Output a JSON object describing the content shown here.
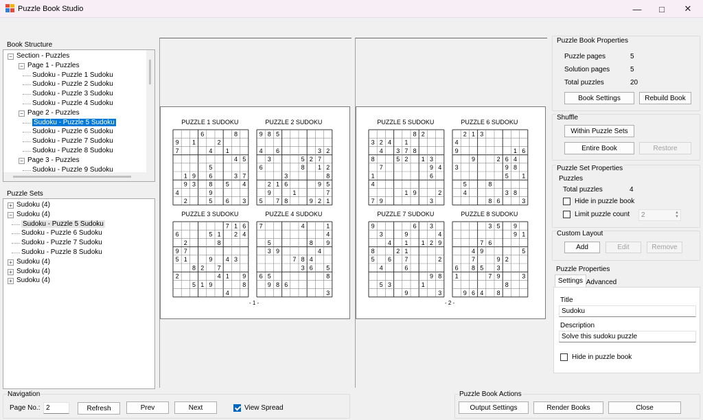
{
  "window": {
    "title": "Puzzle Book Studio",
    "minimize_glyph": "—",
    "maximize_glyph": "□",
    "close_glyph": "✕"
  },
  "book_structure": {
    "label": "Book Structure",
    "rows": [
      {
        "text": "Section - Puzzles",
        "depth": 0,
        "exp": "−"
      },
      {
        "text": "Page 1 - Puzzles",
        "depth": 1,
        "exp": "−"
      },
      {
        "text": "Sudoku - Puzzle 1 Sudoku",
        "depth": 2
      },
      {
        "text": "Sudoku - Puzzle 2 Sudoku",
        "depth": 2
      },
      {
        "text": "Sudoku - Puzzle 3 Sudoku",
        "depth": 2
      },
      {
        "text": "Sudoku - Puzzle 4 Sudoku",
        "depth": 2
      },
      {
        "text": "Page 2 - Puzzles",
        "depth": 1,
        "exp": "−"
      },
      {
        "text": "Sudoku - Puzzle 5 Sudoku",
        "depth": 2,
        "selected": true
      },
      {
        "text": "Sudoku - Puzzle 6 Sudoku",
        "depth": 2
      },
      {
        "text": "Sudoku - Puzzle 7 Sudoku",
        "depth": 2
      },
      {
        "text": "Sudoku - Puzzle 8 Sudoku",
        "depth": 2
      },
      {
        "text": "Page 3 - Puzzles",
        "depth": 1,
        "exp": "−"
      },
      {
        "text": "Sudoku - Puzzle 9 Sudoku",
        "depth": 2
      }
    ]
  },
  "puzzle_sets": {
    "label": "Puzzle Sets",
    "rows": [
      {
        "text": "Sudoku (4)",
        "depth": 0,
        "exp": "+"
      },
      {
        "text": "Sudoku (4)",
        "depth": 0,
        "exp": "−"
      },
      {
        "text": "Sudoku - Puzzle 5 Sudoku",
        "depth": 1,
        "selected": true
      },
      {
        "text": "Sudoku - Puzzle 6 Sudoku",
        "depth": 1
      },
      {
        "text": "Sudoku - Puzzle 7 Sudoku",
        "depth": 1
      },
      {
        "text": "Sudoku - Puzzle 8 Sudoku",
        "depth": 1
      },
      {
        "text": "Sudoku (4)",
        "depth": 0,
        "exp": "+"
      },
      {
        "text": "Sudoku (4)",
        "depth": 0,
        "exp": "+"
      },
      {
        "text": "Sudoku (4)",
        "depth": 0,
        "exp": "+"
      }
    ]
  },
  "pages": [
    {
      "number": "- 1 -",
      "puzzles": [
        {
          "title": "PUZZLE 1 SUDOKU",
          "grid": [
            "...6...8.",
            "9.1..2...",
            "7...4.1..",
            ".......45",
            "....5....",
            ".19.6..37",
            ".93.8.5.4",
            "4...9....",
            ".2..5.6.3"
          ]
        },
        {
          "title": "PUZZLE 2 SUDOKU",
          "grid": [
            "985......",
            ".........",
            "4.6....32",
            ".3...527.",
            "6....8.12",
            "...3....8",
            ".216...95",
            ".9..1...7",
            "5.78..921"
          ]
        },
        {
          "title": "PUZZLE 3 SUDOKU",
          "grid": [
            "......716",
            "6...51.24",
            ".2...8...",
            "97.......",
            "51..9.43.",
            "..82.7...",
            "2....41.9",
            "..519...8",
            "......4.."
          ]
        },
        {
          "title": "PUZZLE 4 SUDOKU",
          "grid": [
            "7....4..1",
            "........4",
            ".5....8.9",
            ".39....4.",
            "....784..",
            ".....36.5",
            "65......8",
            ".986.....",
            "........3"
          ]
        }
      ]
    },
    {
      "number": "- 2 -",
      "puzzles": [
        {
          "title": "PUZZLE 5 SUDOKU",
          "grid": [
            ".....82..",
            "324.1....",
            ".4.378...",
            "8..52.13.",
            ".7.....94",
            "1......6.",
            "4........",
            "....19..2",
            "79.....3."
          ]
        },
        {
          "title": "PUZZLE 6 SUDOKU",
          "grid": [
            ".213.....",
            "4........",
            "9......16",
            "..9..264.",
            "3.....98.",
            "......5.1",
            ".5..8....",
            ".4....38.",
            "....86..3"
          ]
        },
        {
          "title": "PUZZLE 7 SUDOKU",
          "grid": [
            "9....6.3.",
            ".3..9...4",
            "..4.1.129",
            "8..21....",
            "5.6.7...2",
            ".4..6....",
            ".......98",
            ".53...1..",
            "....9...3"
          ]
        },
        {
          "title": "PUZZLE 8 SUDOKU",
          "grid": [
            "....35.9.",
            ".......91",
            "...76....",
            "..49....5",
            "..7..92..",
            "6.85.3...",
            "1...79..3",
            "......8..",
            ".964.8..."
          ]
        }
      ]
    }
  ],
  "book_props": {
    "label": "Puzzle Book Properties",
    "puzzle_pages_label": "Puzzle pages",
    "puzzle_pages": "5",
    "solution_pages_label": "Solution pages",
    "solution_pages": "5",
    "total_puzzles_label": "Total puzzles",
    "total_puzzles": "20",
    "book_settings": "Book Settings",
    "rebuild_book": "Rebuild Book"
  },
  "shuffle": {
    "label": "Shuffle",
    "within_sets": "Within Puzzle Sets",
    "entire_book": "Entire Book",
    "restore": "Restore"
  },
  "set_props": {
    "label": "Puzzle Set Properties",
    "sub_label": "Puzzles",
    "total_label": "Total puzzles",
    "total": "4",
    "hide_label": "Hide in puzzle book",
    "limit_label": "Limit puzzle count",
    "limit_value": "2"
  },
  "custom_layout": {
    "label": "Custom Layout",
    "add": "Add",
    "edit": "Edit",
    "remove": "Remove"
  },
  "puzzle_props": {
    "label": "Puzzle Properties",
    "tab_settings": "Settings",
    "tab_advanced": "Advanced",
    "title_label": "Title",
    "title_value": "Sudoku",
    "description_label": "Description",
    "description_value": "Solve this sudoku puzzle",
    "hide_label": "Hide in puzzle book"
  },
  "navigation": {
    "label": "Navigation",
    "page_label": "Page No.:",
    "page_value": "2",
    "refresh": "Refresh",
    "prev": "Prev",
    "next": "Next",
    "view_spread": "View Spread",
    "view_spread_checked": true
  },
  "book_actions": {
    "label": "Puzzle Book Actions",
    "output_settings": "Output Settings",
    "render_books": "Render Books",
    "close": "Close"
  }
}
